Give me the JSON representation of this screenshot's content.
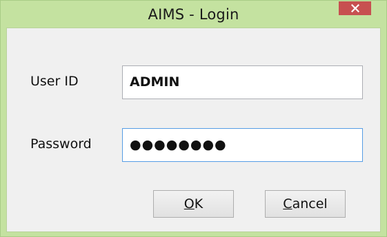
{
  "window": {
    "title": "AIMS - Login",
    "close_icon": "close-icon"
  },
  "form": {
    "user_id_label": "User ID",
    "user_id_value": "ADMIN",
    "password_label": "Password",
    "password_value": "●●●●●●●●"
  },
  "buttons": {
    "ok_mnemonic": "O",
    "ok_rest": "K",
    "cancel_mnemonic": "C",
    "cancel_rest": "ancel"
  },
  "colors": {
    "frame": "#c4e2a0",
    "close_button": "#c75050",
    "focus_border": "#569de5"
  }
}
